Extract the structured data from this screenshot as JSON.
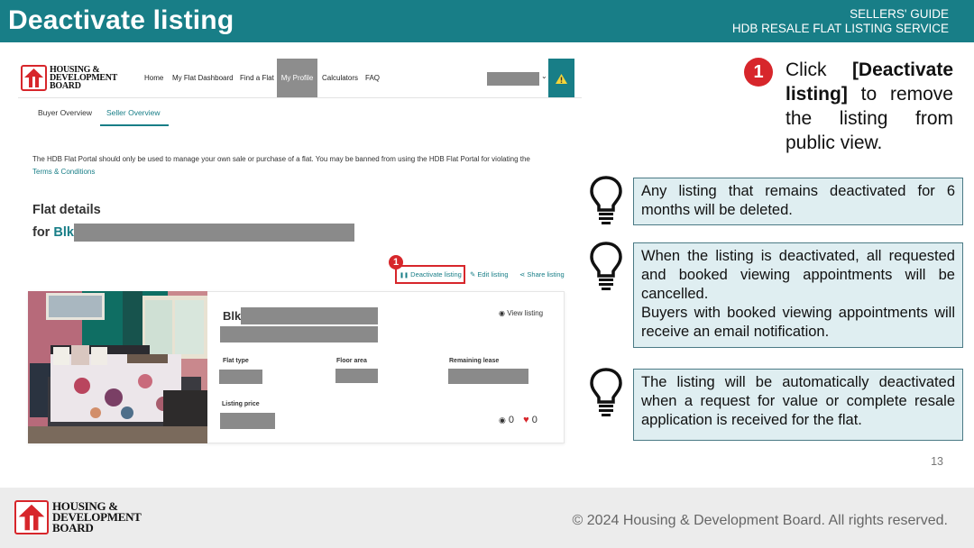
{
  "header": {
    "title": "Deactivate listing",
    "guide_line1": "SELLERS' GUIDE",
    "guide_line2": "HDB RESALE FLAT LISTING SERVICE"
  },
  "portal": {
    "logo_line1": "HOUSING &",
    "logo_line2": "DEVELOPMENT",
    "logo_line3": "BOARD",
    "nav": {
      "home": "Home",
      "dashboard": "My Flat Dashboard",
      "find_flat": "Find a Flat",
      "profile": "My Profile",
      "calculators": "Calculators",
      "faq": "FAQ"
    },
    "tabs": {
      "buyer": "Buyer Overview",
      "seller": "Seller Overview"
    },
    "notice": "The HDB Flat Portal should only be used to manage your own sale or purchase of a flat. You may be banned from using the HDB Flat Portal for violating the",
    "terms_link": "Terms & Conditions",
    "flat_heading": "Flat details",
    "flat_for": "for",
    "flat_blk": "Blk",
    "actions": {
      "deactivate": "Deactivate listing",
      "edit": "Edit listing",
      "share": "Share listing"
    },
    "card": {
      "blk": "Blk",
      "view_listing": "View listing",
      "flat_type_label": "Flat type",
      "floor_area_label": "Floor area",
      "remaining_lease_label": "Remaining lease",
      "listing_price_label": "Listing price",
      "views_count": "0",
      "likes_count": "0"
    },
    "step_marker": "1"
  },
  "step": {
    "number": "1",
    "text_click": "Click",
    "text_bold": "[Deactivate listing]",
    "text_rest": "to remove the listing from public view."
  },
  "tips": [
    {
      "text": "Any listing that remains deactivated for 6 months will be deleted."
    },
    {
      "text_1": "When the listing is deactivated, all requested and booked viewing appointments will be cancelled.",
      "text_2": "Buyers with booked viewing appointments will receive an email notification."
    },
    {
      "text": "The listing will be automatically deactivated when a request for value or complete resale application is received for the flat."
    }
  ],
  "page_number": "13",
  "footer": {
    "logo_line1": "HOUSING &",
    "logo_line2": "DEVELOPMENT",
    "logo_line3": "BOARD",
    "copyright": "© 2024 Housing & Development Board. All rights reserved."
  },
  "colors": {
    "teal": "#187e87",
    "red": "#d7262b",
    "tip_bg": "#dfeef1"
  }
}
